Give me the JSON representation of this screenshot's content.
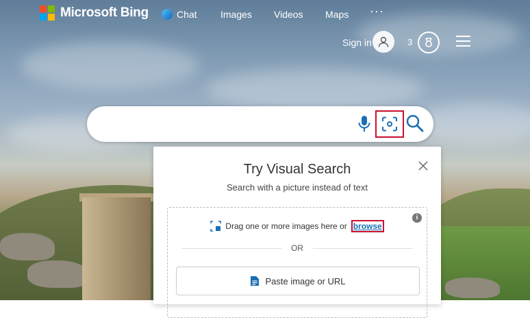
{
  "brand": {
    "name": "Microsoft Bing",
    "logo_colors": [
      "#f25022",
      "#7fba00",
      "#00a4ef",
      "#ffb900"
    ]
  },
  "nav": {
    "items": [
      {
        "label": "Chat",
        "icon": "bing-chat-icon"
      },
      {
        "label": "Images"
      },
      {
        "label": "Videos"
      },
      {
        "label": "Maps"
      }
    ],
    "more_label": "···"
  },
  "account": {
    "sign_in_label": "Sign in",
    "rewards_count": "3"
  },
  "search": {
    "placeholder": "",
    "value": "",
    "icons": [
      "microphone-icon",
      "visual-search-icon",
      "search-icon"
    ],
    "accent_color": "#1a6fb5"
  },
  "visual_search_panel": {
    "title": "Try Visual Search",
    "subtitle": "Search with a picture instead of text",
    "drop_text": "Drag one or more images here or",
    "browse_label": "browse",
    "or_label": "OR",
    "paste_label": "Paste image or URL",
    "highlight_color": "#c8102e"
  }
}
